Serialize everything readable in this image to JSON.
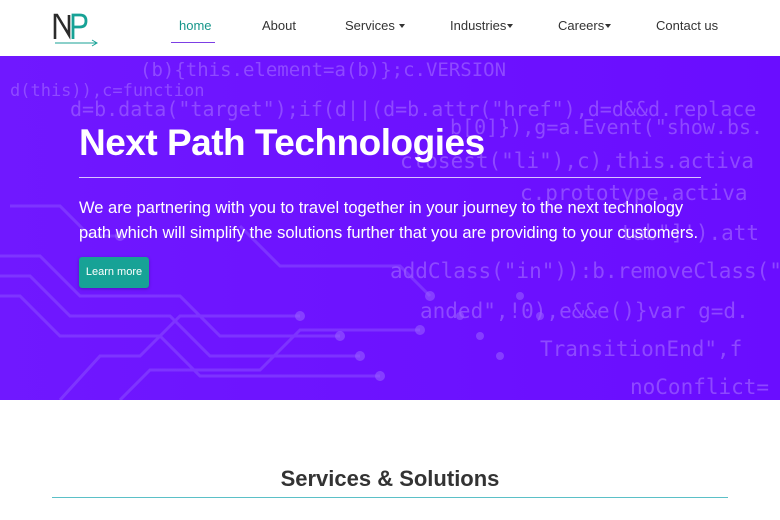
{
  "brand": {
    "logo_icon": "np-logo-icon",
    "logo_letters": "NP",
    "colors": {
      "dark": "#2b2b2b",
      "accent": "#17a296"
    }
  },
  "nav": {
    "items": [
      {
        "label": "home",
        "active": true
      },
      {
        "label": "About"
      },
      {
        "label": "Services",
        "dropdown": true
      },
      {
        "label": "Industries",
        "dropdown": true
      },
      {
        "label": "Careers",
        "dropdown": true
      },
      {
        "label": "Contact us"
      }
    ],
    "active_color": "#17968a",
    "underline_color": "#7c3fe4"
  },
  "hero": {
    "title": "Next Path Technologies",
    "text": "We are partnering with you to travel together in your journey to the next technology path which will simplify the solutions further that you are providing to your customers.",
    "button_label": "Learn more",
    "background_color": "#6a0dff",
    "button_color": "#17a296",
    "background_code": [
      "(b){this.element=a(b)};c.VERSION",
      "d(this)),c=function",
      "d=b.data(\"target\");if(d||(d=b.attr(\"href\"),d=d&&d.replace",
      "b[0]}),g=a.Event(\"show.bs.",
      "closest(\"li\"),c),this.activa",
      "c.prototype.activa",
      "tab\"]').att",
      "addClass(\"in\")):b.removeClass(\"f",
      "anded\",!0),e&&e()}var g=d.",
      "TransitionEnd\",f",
      "noConflict="
    ]
  },
  "services": {
    "title": "Services & Solutions",
    "rule_color": "#5bc0c7"
  }
}
